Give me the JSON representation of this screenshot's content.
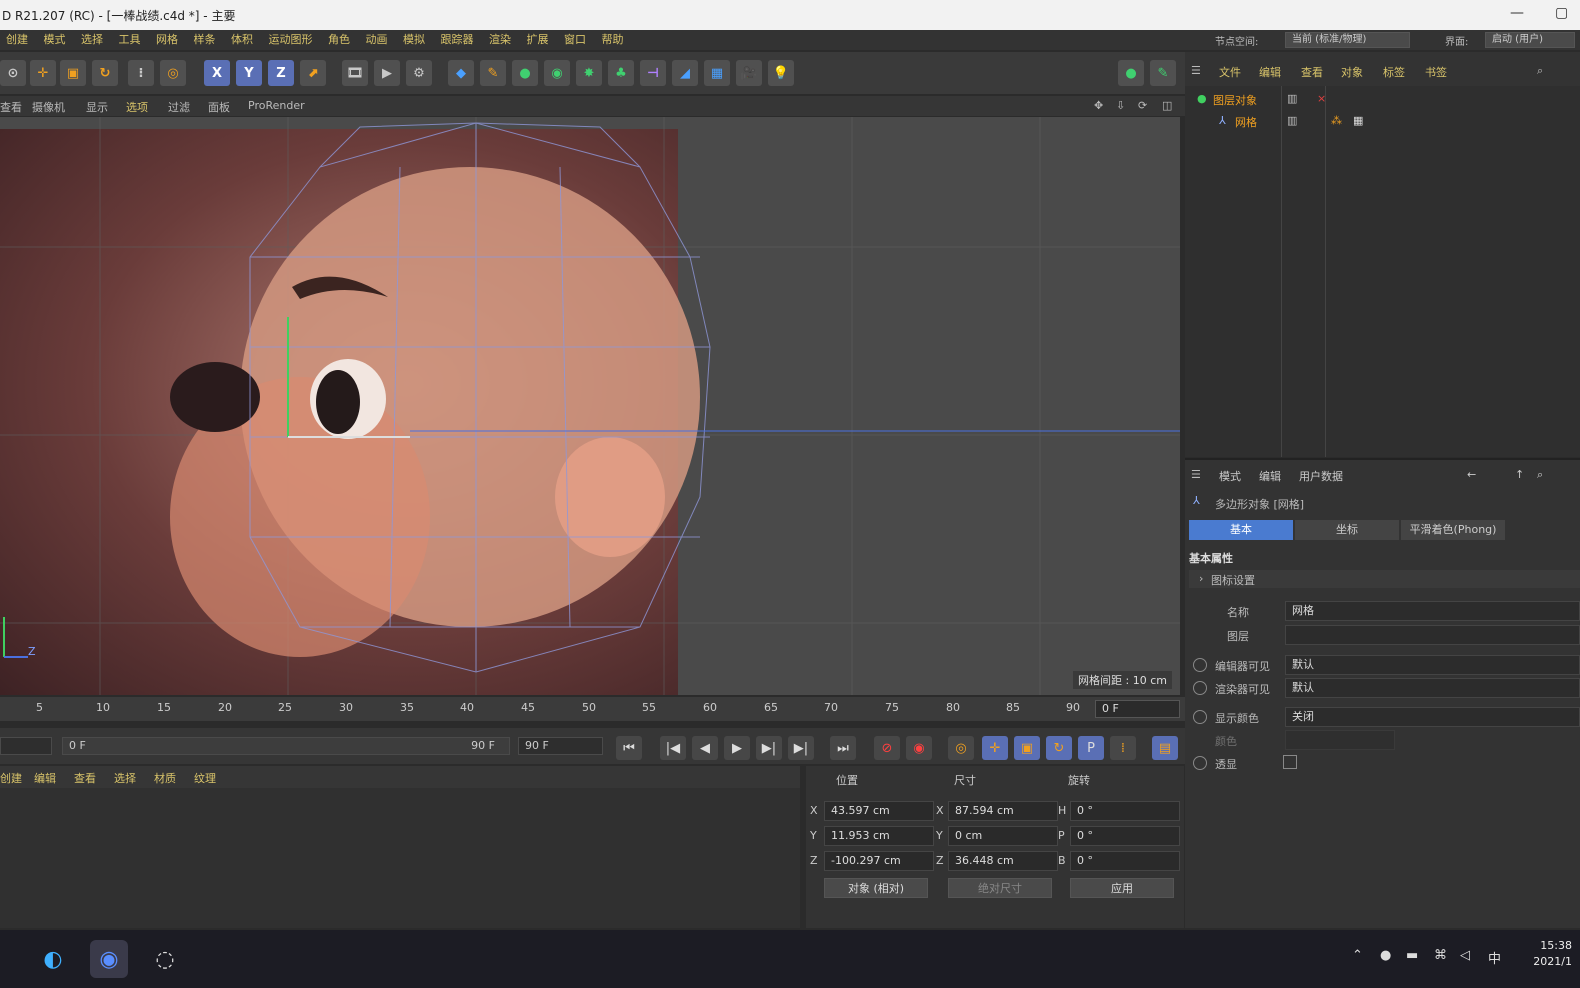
{
  "window": {
    "title": "D R21.207 (RC) - [一棒战绩.c4d *] - 主要",
    "controls": [
      "—",
      "▢"
    ]
  },
  "menu": [
    "创建",
    "模式",
    "选择",
    "工具",
    "网格",
    "样条",
    "体积",
    "运动图形",
    "角色",
    "动画",
    "模拟",
    "跟踪器",
    "渲染",
    "扩展",
    "窗口",
    "帮助"
  ],
  "layout": {
    "label": "界面:",
    "value": "启动 (用户)",
    "node_space_label": "节点空间:",
    "node_space_value": "当前 (标准/物理)"
  },
  "viewport": {
    "menu": [
      "查看",
      "摄像机",
      "显示",
      "选项",
      "过滤",
      "面板",
      "ProRender"
    ],
    "grid_note": "网格间距 : 10 cm",
    "axis_z": "Z"
  },
  "timeline": {
    "ticks": [
      "5",
      "10",
      "15",
      "20",
      "25",
      "30",
      "35",
      "40",
      "45",
      "50",
      "55",
      "60",
      "65",
      "70",
      "75",
      "80",
      "85",
      "90"
    ],
    "current_frame": "0 F",
    "start_frame": "0 F",
    "end_frame": "90 F",
    "max_frame": "90 F"
  },
  "material_menu": [
    "创建",
    "编辑",
    "查看",
    "选择",
    "材质",
    "纹理"
  ],
  "coords": {
    "headers": [
      "位置",
      "尺寸",
      "旋转"
    ],
    "rows": [
      {
        "axis": "X",
        "pos": "43.597 cm",
        "size_axis": "X",
        "size": "87.594 cm",
        "rot_axis": "H",
        "rot": "0 °"
      },
      {
        "axis": "Y",
        "pos": "11.953 cm",
        "size_axis": "Y",
        "size": "0 cm",
        "rot_axis": "P",
        "rot": "0 °"
      },
      {
        "axis": "Z",
        "pos": "-100.297 cm",
        "size_axis": "Z",
        "size": "36.448 cm",
        "rot_axis": "B",
        "rot": "0 °"
      }
    ],
    "mode": "对象 (相对)",
    "size_mode": "绝对尺寸",
    "apply": "应用"
  },
  "object_manager": {
    "menu": [
      "文件",
      "编辑",
      "查看",
      "对象",
      "标签",
      "书签"
    ],
    "objects": [
      {
        "name": "图层对象"
      },
      {
        "name": "网格"
      }
    ]
  },
  "attribute_manager": {
    "menu": [
      "模式",
      "编辑",
      "用户数据"
    ],
    "object_title": "多边形对象 [网格]",
    "tabs": [
      "基本",
      "坐标",
      "平滑着色(Phong)"
    ],
    "section": "基本属性",
    "subsection": "图标设置",
    "rows": [
      {
        "label": "名称",
        "value": "网格"
      },
      {
        "label": "图层",
        "value": ""
      },
      {
        "label": "编辑器可见",
        "value": "默认"
      },
      {
        "label": "渲染器可见",
        "value": "默认"
      },
      {
        "label": "显示颜色",
        "value": "关闭"
      },
      {
        "label": "颜色",
        "value": ""
      },
      {
        "label": "透显",
        "value": ""
      }
    ]
  },
  "taskbar": {
    "time": "15:38",
    "date": "2021/1"
  }
}
